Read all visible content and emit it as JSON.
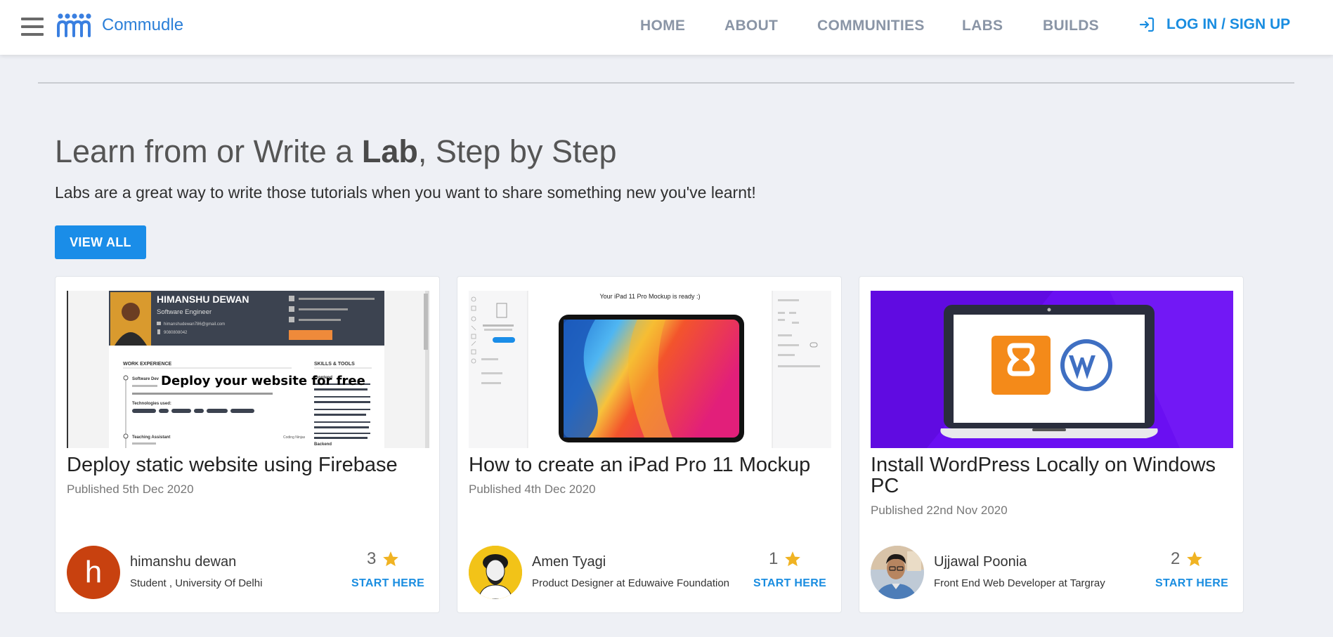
{
  "header": {
    "brand": "Commudle",
    "nav": [
      "HOME",
      "ABOUT",
      "COMMUNITIES",
      "LABS",
      "BUILDS"
    ],
    "login": "LOG IN / SIGN UP",
    "menu_icon": "hamburger-menu-icon",
    "login_icon": "login-arrow-icon"
  },
  "hero": {
    "title_pre": "Learn from or Write a ",
    "title_bold": "Lab",
    "title_post": ", Step by Step",
    "subtitle": "Labs are a great way to write those tutorials when you want to share something new you've learnt!",
    "view_all": "VIEW ALL"
  },
  "cards": [
    {
      "title": "Deploy static website using Firebase",
      "date": "Published 5th Dec 2020",
      "author": "himanshu dewan",
      "role": "Student , University Of Delhi",
      "avatar_letter": "h",
      "rating": "3",
      "cta": "START HERE",
      "thumb": {
        "name": "HIMANSHU DEWAN",
        "job": "Software Engineer",
        "email": "himanshudewan786@gmail.com",
        "phone": "9080808042",
        "work_experience": "WORK EXPERIENCE",
        "skills": "SKILLS & TOOLS",
        "overlay": "Deploy your website for free",
        "frontend": "Frontend",
        "backend": "Backend",
        "job1": "Software Dev",
        "job2": "Teaching Assistant",
        "tech_used": "Technologies used:",
        "org": "Coding Ninjas"
      }
    },
    {
      "title": "How to create an iPad Pro 11 Mockup",
      "date": "Published 4th Dec 2020",
      "author": "Amen Tyagi",
      "role": "Product Designer at Eduwaive Foundation",
      "rating": "1",
      "cta": "START HERE",
      "thumb": {
        "caption": "Your iPad 11 Pro Mockup is ready :)"
      }
    },
    {
      "title": "Install WordPress Locally on Windows PC",
      "date": "Published 22nd Nov 2020",
      "author": "Ujjawal Poonia",
      "role": "Front End Web Developer at Targray",
      "rating": "2",
      "cta": "START HERE"
    }
  ],
  "colors": {
    "accent": "#1a8de8",
    "star": "#f0b323",
    "background": "#eef0f5",
    "avatar_letter_bg": "#c8410f",
    "wp_purple": "#6a0ff2"
  }
}
